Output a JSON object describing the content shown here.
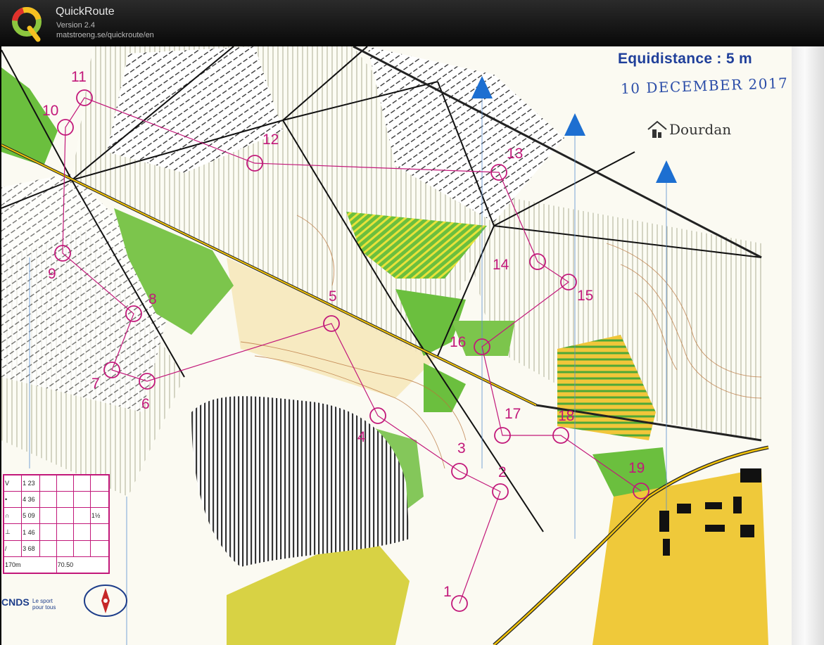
{
  "app": {
    "title": "QuickRoute",
    "version": "Version 2.4",
    "url": "matstroeng.se/quickroute/en"
  },
  "map": {
    "equidistance": "Equidistance : 5 m",
    "date": "10 DECEMBER 2017",
    "club": "Dourdan",
    "sponsor_main": "CNDS",
    "sponsor_sub": "Le sport pour tous",
    "controls": [
      "1",
      "2",
      "3",
      "4",
      "5",
      "6",
      "7",
      "8",
      "9",
      "10",
      "11",
      "12",
      "13",
      "14",
      "15",
      "16",
      "17",
      "18",
      "19"
    ],
    "legend_rows": [
      {
        "symbol": "V",
        "value": "1 23"
      },
      {
        "symbol": "•",
        "value": "4 36"
      },
      {
        "symbol": "∩",
        "value": "5 09"
      },
      {
        "symbol": "⊥",
        "value": "1 46"
      },
      {
        "symbol": "/",
        "value": "3 68"
      }
    ],
    "legend_extra": "1½",
    "scale_text": "170m",
    "scale_text2": "70.50"
  },
  "colors": {
    "course": "#c2187a",
    "north": "#1d6fd1",
    "forest_green": "#5fb43a",
    "yellow": "#f2c72b"
  }
}
